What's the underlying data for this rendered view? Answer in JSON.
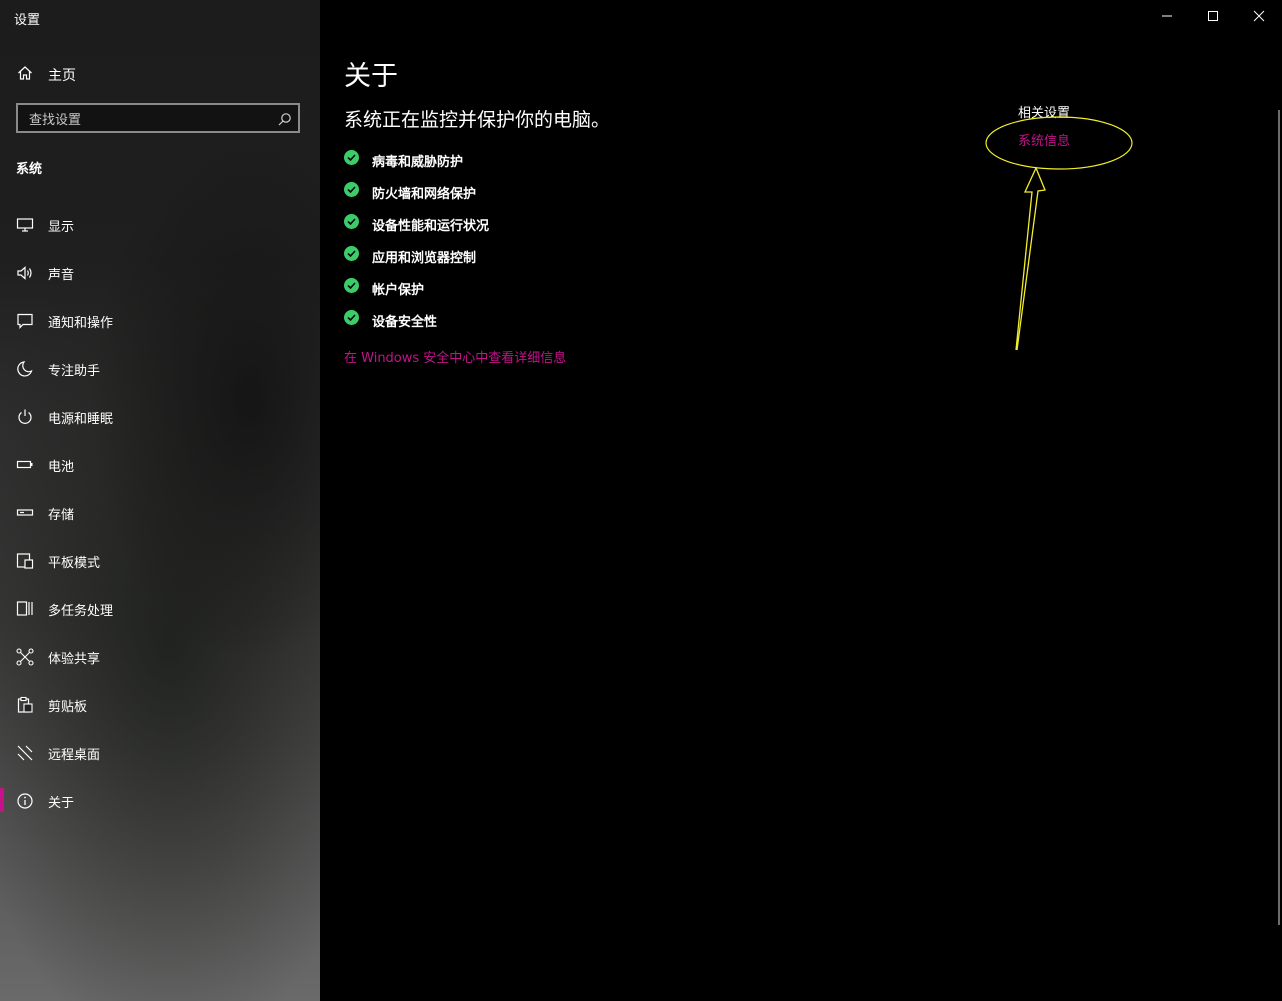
{
  "window": {
    "title": "设置"
  },
  "sidebar": {
    "home_label": "主页",
    "search_placeholder": "查找设置",
    "section_title": "系统",
    "items": [
      {
        "label": "显示",
        "icon": "display-icon"
      },
      {
        "label": "声音",
        "icon": "speaker-icon"
      },
      {
        "label": "通知和操作",
        "icon": "message-icon"
      },
      {
        "label": "专注助手",
        "icon": "moon-icon"
      },
      {
        "label": "电源和睡眠",
        "icon": "power-icon"
      },
      {
        "label": "电池",
        "icon": "battery-icon"
      },
      {
        "label": "存储",
        "icon": "storage-icon"
      },
      {
        "label": "平板模式",
        "icon": "tablet-icon"
      },
      {
        "label": "多任务处理",
        "icon": "multitask-icon"
      },
      {
        "label": "体验共享",
        "icon": "share-icon"
      },
      {
        "label": "剪贴板",
        "icon": "clipboard-icon"
      },
      {
        "label": "远程桌面",
        "icon": "remote-icon"
      },
      {
        "label": "关于",
        "icon": "info-icon",
        "active": true
      }
    ]
  },
  "main": {
    "title": "关于",
    "status": "系统正在监控并保护你的电脑。",
    "protections": [
      "病毒和威胁防护",
      "防火墙和网络保护",
      "设备性能和运行状况",
      "应用和浏览器控制",
      "帐户保护",
      "设备安全性"
    ],
    "security_link": "在 Windows 安全中心中查看详细信息",
    "related_title": "相关设置",
    "related_link": "系统信息"
  },
  "colors": {
    "accent": "#c4128b",
    "check": "#3ccc6b",
    "annotation": "#f2ee2a"
  }
}
